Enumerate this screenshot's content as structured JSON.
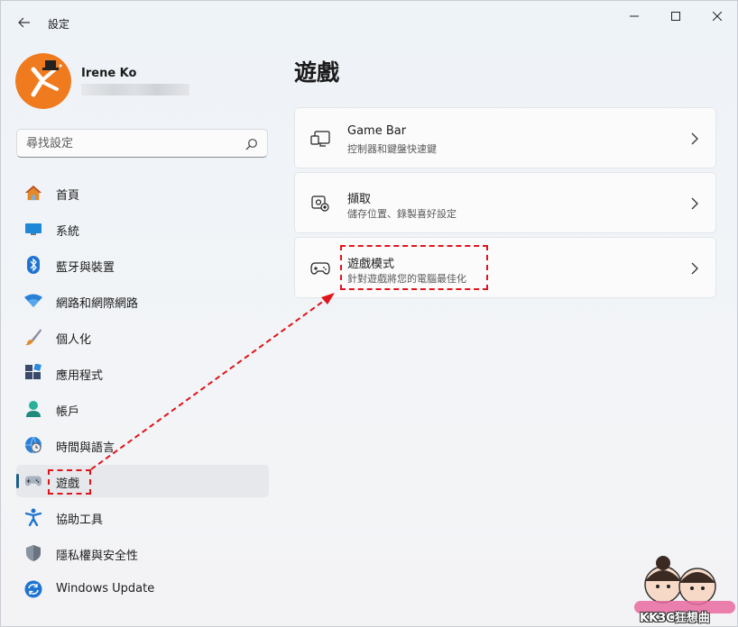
{
  "window": {
    "title": "設定",
    "controls": {
      "minimize": "minimize-icon",
      "maximize": "maximize-icon",
      "close": "close-icon"
    }
  },
  "profile": {
    "name": "Irene Ko"
  },
  "search": {
    "placeholder": "尋找設定"
  },
  "nav": [
    {
      "label": "首頁",
      "icon": "home-icon"
    },
    {
      "label": "系統",
      "icon": "monitor-icon"
    },
    {
      "label": "藍牙與裝置",
      "icon": "bluetooth-icon"
    },
    {
      "label": "網路和網際網路",
      "icon": "wifi-icon"
    },
    {
      "label": "個人化",
      "icon": "brush-icon"
    },
    {
      "label": "應用程式",
      "icon": "apps-icon"
    },
    {
      "label": "帳戶",
      "icon": "person-icon"
    },
    {
      "label": "時間與語言",
      "icon": "globe-clock-icon"
    },
    {
      "label": "遊戲",
      "icon": "gamepad-icon",
      "selected": true
    },
    {
      "label": "協助工具",
      "icon": "accessibility-icon"
    },
    {
      "label": "隱私權與安全性",
      "icon": "shield-icon"
    },
    {
      "label": "Windows Update",
      "icon": "update-icon"
    }
  ],
  "main": {
    "title": "遊戲",
    "cards": [
      {
        "title": "Game Bar",
        "subtitle": "控制器和鍵盤快速鍵",
        "icon": "game-bar-icon"
      },
      {
        "title": "擷取",
        "subtitle": "儲存位置、錄製喜好設定",
        "icon": "capture-icon"
      },
      {
        "title": "遊戲模式",
        "subtitle": "針對遊戲將您的電腦最佳化",
        "icon": "game-mode-icon"
      }
    ]
  },
  "watermark": {
    "text": "KK3C狂想曲"
  },
  "colors": {
    "accent": "#1b5f86",
    "annotation": "#e0141b",
    "avatar": "#f07a1e"
  }
}
